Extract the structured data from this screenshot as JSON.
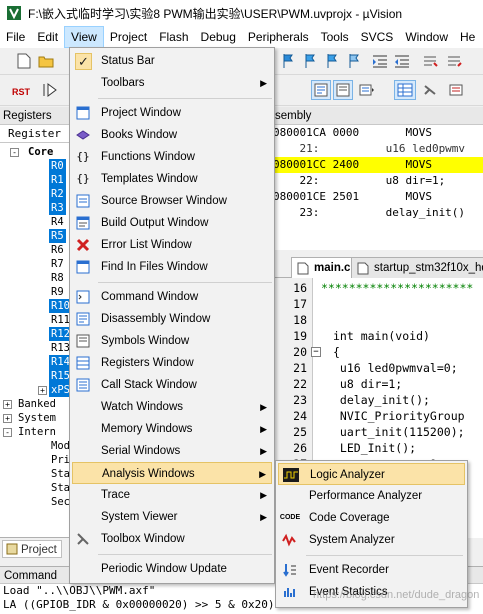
{
  "window": {
    "title": "F:\\嵌入式临时学习\\实验8 PWM输出实验\\USER\\PWM.uvprojx - µVision"
  },
  "menubar": [
    "File",
    "Edit",
    "View",
    "Project",
    "Flash",
    "Debug",
    "Peripherals",
    "Tools",
    "SVCS",
    "Window",
    "He"
  ],
  "registers_panel": {
    "title": "Registers",
    "header": "Register",
    "core_label": "Core",
    "registers": [
      "R0",
      "R1",
      "R2",
      "R3",
      "R4",
      "R5",
      "R6",
      "R7",
      "R8",
      "R9",
      "R10",
      "R11",
      "R12",
      "R13",
      "R14",
      "R15",
      "xPS"
    ],
    "groups": [
      "Banked",
      "System",
      "Intern"
    ],
    "internal_items": [
      "Mod",
      "Pri",
      "Sta",
      "Sta",
      "Sec"
    ],
    "bottom_tab": "Project"
  },
  "disassembly": {
    "title": "sembly",
    "lines": [
      {
        "text": "080001CA 0000       MOVS",
        "highlight": false
      },
      {
        "text": "    21:          u16 led0pwmv",
        "highlight": false
      },
      {
        "text": "080001CC 2400       MOVS",
        "highlight": true
      },
      {
        "text": "    22:          u8 dir=1;",
        "highlight": false
      },
      {
        "text": "080001CE 2501       MOVS",
        "highlight": false
      },
      {
        "text": "    23:          delay_init()",
        "highlight": false
      }
    ]
  },
  "editor": {
    "tabs": [
      "main.c",
      "startup_stm32f10x_hd"
    ],
    "lines": [
      {
        "n": "16",
        "code": "**********************"
      },
      {
        "n": "17",
        "code": ""
      },
      {
        "n": "18",
        "code": ""
      },
      {
        "n": "19",
        "code": "int main(void)"
      },
      {
        "n": "20",
        "code": "{"
      },
      {
        "n": "21",
        "code": " u16 led0pwmval=0;"
      },
      {
        "n": "22",
        "code": " u8 dir=1;"
      },
      {
        "n": "23",
        "code": " delay_init();"
      },
      {
        "n": "24",
        "code": " NVIC_PriorityGroup"
      },
      {
        "n": "25",
        "code": " uart_init(115200);"
      },
      {
        "n": "26",
        "code": " LED_Init();"
      },
      {
        "n": "27",
        "code": "              9,"
      },
      {
        "n": "28",
        "code": ""
      },
      {
        "n": "29",
        "code": ""
      },
      {
        "n": "30",
        "code": "            va"
      },
      {
        "n": "31",
        "code": ""
      }
    ]
  },
  "view_menu": {
    "status_bar": "Status Bar",
    "toolbars": "Toolbars",
    "project_window": "Project Window",
    "books_window": "Books Window",
    "functions_window": "Functions Window",
    "templates_window": "Templates Window",
    "source_browser_window": "Source Browser Window",
    "build_output_window": "Build Output Window",
    "error_list_window": "Error List Window",
    "find_in_files_window": "Find In Files Window",
    "command_window": "Command Window",
    "disassembly_window": "Disassembly Window",
    "symbols_window": "Symbols Window",
    "registers_window": "Registers Window",
    "call_stack_window": "Call Stack Window",
    "watch_windows": "Watch Windows",
    "memory_windows": "Memory Windows",
    "serial_windows": "Serial Windows",
    "analysis_windows": "Analysis Windows",
    "trace": "Trace",
    "system_viewer": "System Viewer",
    "toolbox_window": "Toolbox Window",
    "periodic_window_update": "Periodic Window Update"
  },
  "analysis_submenu": {
    "logic_analyzer": "Logic Analyzer",
    "performance_analyzer": "Performance Analyzer",
    "code_coverage": "Code Coverage",
    "system_analyzer": "System Analyzer",
    "event_recorder": "Event Recorder",
    "event_statistics": "Event Statistics"
  },
  "command_window": {
    "title": "Command",
    "lines": [
      "Load \"..\\\\OBJ\\\\PWM.axf\"",
      "LA ((GPIOB_IDR & 0x00000020) >> 5 & 0x20) >> 5"
    ]
  },
  "watermark": "https://blog.csdn.net/dude_dragon",
  "colors": {
    "menu_highlight": "#fbe3a8",
    "selection": "#0078d7",
    "current_line": "#ffff00",
    "active_menubar": "#cce8ff"
  }
}
